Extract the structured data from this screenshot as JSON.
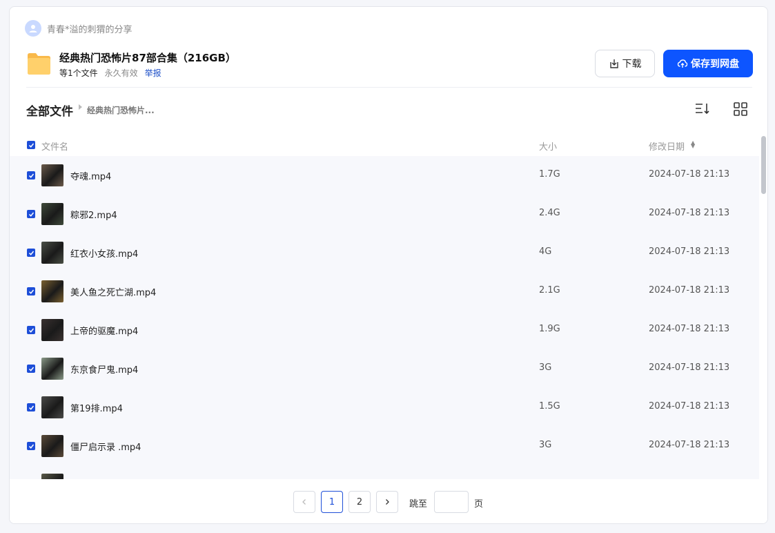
{
  "sharer": {
    "name": "青春*溢的刺猬的分享"
  },
  "share": {
    "title": "经典热门恐怖片87部合集（216GB）",
    "file_count": "等1个文件",
    "expire": "永久有效",
    "report": "举报"
  },
  "actions": {
    "download": "下载",
    "save": "保存到网盘"
  },
  "breadcrumb": {
    "root": "全部文件",
    "current": "经典热门恐怖片..."
  },
  "table": {
    "headers": {
      "name": "文件名",
      "size": "大小",
      "date": "修改日期"
    },
    "rows": [
      {
        "name": "夺魂.mp4",
        "size": "1.7G",
        "date": "2024-07-18 21:13",
        "thumb": "#6b5a4a"
      },
      {
        "name": "粽邪2.mp4",
        "size": "2.4G",
        "date": "2024-07-18 21:13",
        "thumb": "#3f4a3a"
      },
      {
        "name": "红衣小女孩.mp4",
        "size": "4G",
        "date": "2024-07-18 21:13",
        "thumb": "#4a4f45"
      },
      {
        "name": "美人鱼之死亡湖.mp4",
        "size": "2.1G",
        "date": "2024-07-18 21:13",
        "thumb": "#7a6030"
      },
      {
        "name": "上帝的驱魔.mp4",
        "size": "1.9G",
        "date": "2024-07-18 21:13",
        "thumb": "#3a3230"
      },
      {
        "name": "东京食尸鬼.mp4",
        "size": "3G",
        "date": "2024-07-18 21:13",
        "thumb": "#8a9a88"
      },
      {
        "name": "第19排.mp4",
        "size": "1.5G",
        "date": "2024-07-18 21:13",
        "thumb": "#4a4a48"
      },
      {
        "name": "僵尸启示录 .mp4",
        "size": "3G",
        "date": "2024-07-18 21:13",
        "thumb": "#5a4a38"
      },
      {
        "name": "",
        "size": "",
        "date": "",
        "thumb": "#5a5a48"
      }
    ]
  },
  "pagination": {
    "pages": [
      "1",
      "2"
    ],
    "current": "1",
    "jump_label": "跳至",
    "jump_suffix": "页"
  },
  "colors": {
    "accent": "#0d55ff",
    "checkbox": "#1d4ed8"
  }
}
